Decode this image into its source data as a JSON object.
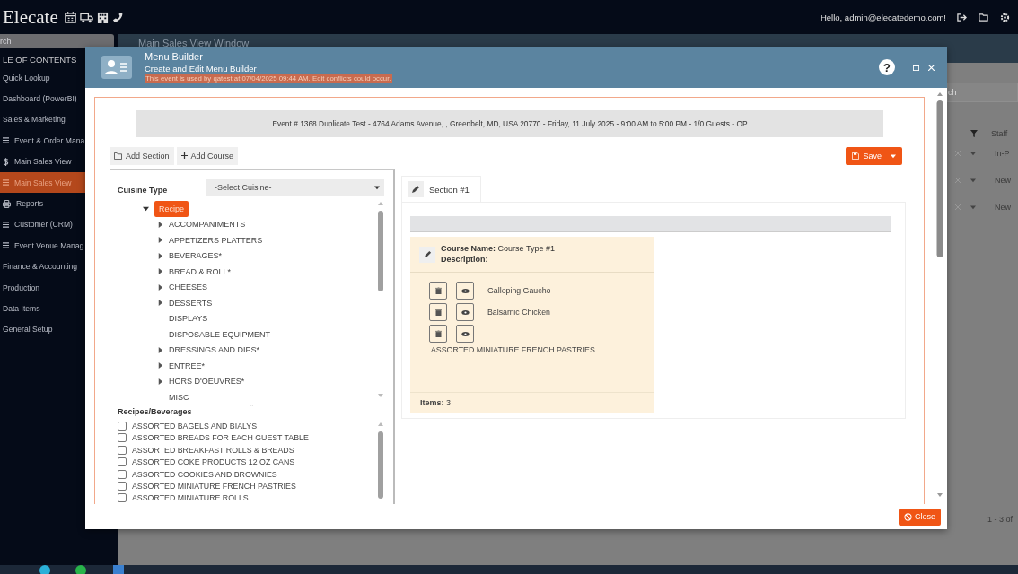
{
  "topbar": {
    "logo": "Elecate",
    "greeting": "Hello, admin@elecatedemo.com!"
  },
  "sidebar": {
    "search": {
      "placeholder": "rch"
    },
    "heading": "LE OF CONTENTS",
    "items": [
      {
        "label": "Quick Lookup",
        "kind": "plain",
        "selected": false
      },
      {
        "label": "Dashboard (PowerBI)",
        "kind": "plain",
        "selected": false
      },
      {
        "label": "Sales & Marketing",
        "kind": "plain",
        "selected": false
      },
      {
        "label": "Event & Order Mana",
        "kind": "menu",
        "selected": false
      },
      {
        "label": "Main Sales View",
        "kind": "money",
        "selected": false
      },
      {
        "label": "Main Sales View",
        "kind": "menu",
        "selected": true
      },
      {
        "label": "Reports",
        "kind": "printer",
        "selected": false
      },
      {
        "label": "Customer (CRM)",
        "kind": "menu",
        "selected": false
      },
      {
        "label": "Event Venue Manag",
        "kind": "menu",
        "selected": false
      },
      {
        "label": "Finance & Accounting",
        "kind": "plain",
        "selected": false
      },
      {
        "label": "Production",
        "kind": "plain",
        "selected": false
      },
      {
        "label": "Data Items",
        "kind": "plain",
        "selected": false
      },
      {
        "label": "General Setup",
        "kind": "plain",
        "selected": false
      }
    ]
  },
  "main": {
    "window_title": "Main Sales View Window",
    "search": {
      "placeholder": "ch"
    },
    "column_header": "Staff",
    "rows": [
      {
        "column_2": "In-P"
      },
      {
        "column_2": "New"
      },
      {
        "column_2": "New"
      }
    ],
    "pager": "1 - 3 of"
  },
  "modal": {
    "title": "Menu Builder",
    "subtitle": "Create and Edit Menu Builder",
    "warning": "This event is used by qatest at 07/04/2025 09:44 AM. Edit conflicts could occur.",
    "help": "?",
    "event_banner": "Event # 1368 Duplicate Test - 4764 Adams Avenue, , Greenbelt, MD, USA 20770 - Friday, 11 July 2025 - 9:00 AM to 5:00 PM - 1/0 Guests - OP",
    "toolbar": {
      "add_section": "Add Section",
      "add_course": "Add Course",
      "save": "Save"
    },
    "cuisine": {
      "label": "Cuisine Type",
      "select": "-Select Cuisine-"
    },
    "tree": [
      {
        "label": "Recipe",
        "kind": "folder",
        "selected": true,
        "expanded": true,
        "children": [
          {
            "label": "ACCOMPANIMENTS",
            "kind": "folder",
            "selected": false,
            "expanded": false
          },
          {
            "label": "APPETIZERS PLATTERS",
            "kind": "folder",
            "selected": false,
            "expanded": false
          },
          {
            "label": "BEVERAGES*",
            "kind": "folder",
            "selected": false,
            "expanded": false
          },
          {
            "label": "BREAD & ROLL*",
            "kind": "folder",
            "selected": false,
            "expanded": false
          },
          {
            "label": "CHEESES",
            "kind": "folder",
            "selected": false,
            "expanded": false
          },
          {
            "label": "DESSERTS",
            "kind": "folder",
            "selected": false,
            "expanded": false
          },
          {
            "label": "DISPLAYS",
            "kind": "leaf",
            "selected": false
          },
          {
            "label": "DISPOSABLE EQUIPMENT",
            "kind": "leaf",
            "selected": false
          },
          {
            "label": "DRESSINGS AND DIPS*",
            "kind": "folder",
            "selected": false,
            "expanded": false
          },
          {
            "label": "ENTREE*",
            "kind": "folder",
            "selected": false,
            "expanded": false
          },
          {
            "label": "HORS D'OEUVRES*",
            "kind": "folder",
            "selected": false,
            "expanded": false
          },
          {
            "label": "MISC",
            "kind": "leaf",
            "selected": false
          }
        ]
      }
    ],
    "recipes": {
      "label": "Recipes/Beverages",
      "items": [
        {
          "label": "ASSORTED BAGELS AND BIALYS",
          "checked": false
        },
        {
          "label": "ASSORTED BREADS FOR EACH GUEST TABLE",
          "checked": false
        },
        {
          "label": "ASSORTED BREAKFAST ROLLS & BREADS",
          "checked": false
        },
        {
          "label": "ASSORTED COKE PRODUCTS 12 OZ CANS",
          "checked": false
        },
        {
          "label": "ASSORTED COOKIES AND BROWNIES",
          "checked": false
        },
        {
          "label": "ASSORTED MINIATURE FRENCH PASTRIES",
          "checked": false
        },
        {
          "label": "ASSORTED MINIATURE ROLLS",
          "checked": false
        }
      ]
    },
    "sections": [
      {
        "label": "Section #1",
        "selected": true
      }
    ],
    "course": {
      "name_line": "**Course Name:** Course Type #1",
      "description": "Description:",
      "items": [
        {
          "name": "Galloping Gaucho"
        },
        {
          "name": "Balsamic Chicken"
        },
        {
          "name": "ASSORTED MINIATURE FRENCH PASTRIES"
        }
      ],
      "count": "**Items:** 3"
    },
    "close": "Close"
  }
}
